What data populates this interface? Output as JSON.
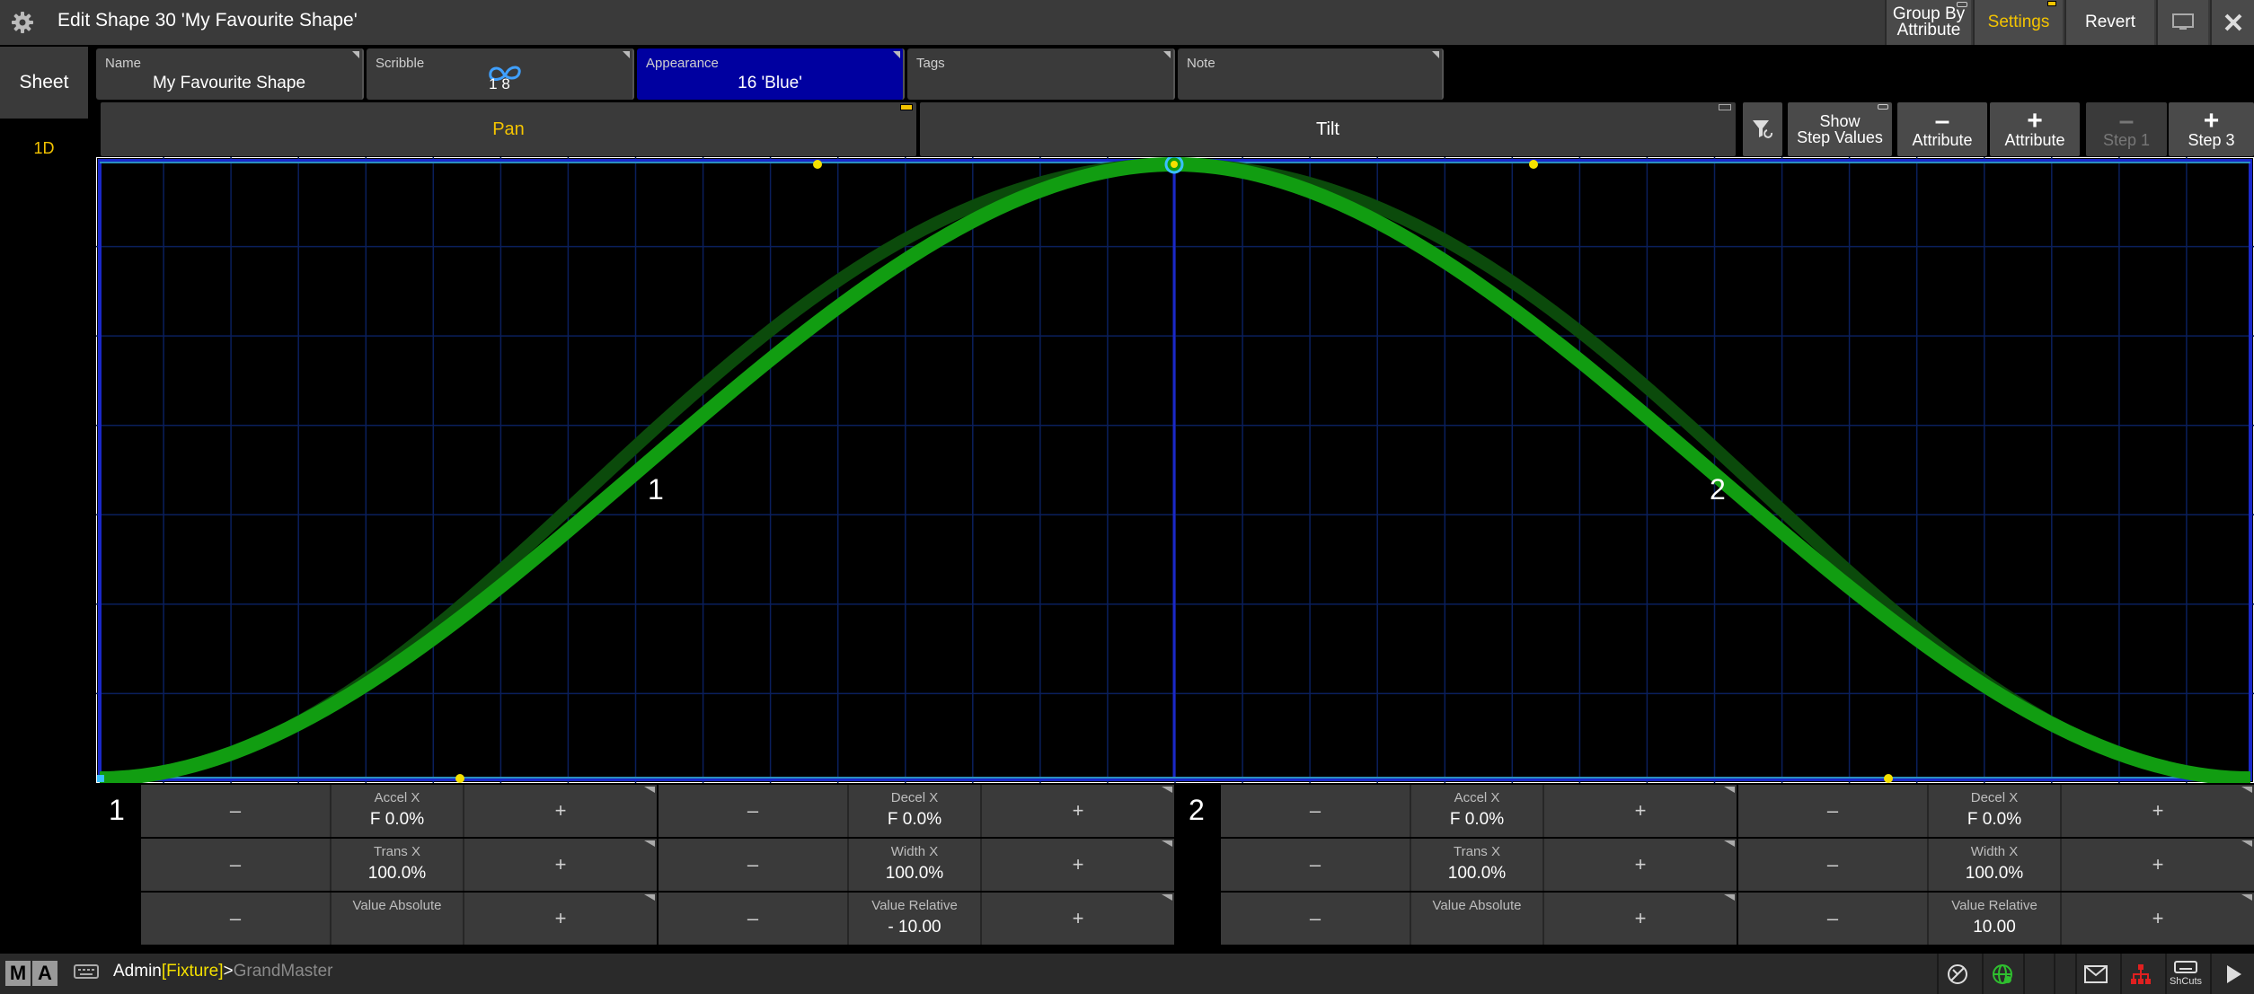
{
  "titlebar": {
    "title": "Edit Shape 30 'My Favourite Shape'",
    "group_by_line1": "Group By",
    "group_by_line2": "Attribute",
    "settings": "Settings",
    "revert": "Revert",
    "accent_color": "#f4c400"
  },
  "sidebar": {
    "sheet": "Sheet",
    "mode": "1D"
  },
  "fields": {
    "name_label": "Name",
    "name_value": "My Favourite Shape",
    "scribble_label": "Scribble",
    "scribble_value": "1 8",
    "appearance_label": "Appearance",
    "appearance_value": "16 'Blue'",
    "appearance_color": "#0000a0",
    "tags_label": "Tags",
    "note_label": "Note"
  },
  "attributes": {
    "pan": "Pan",
    "tilt": "Tilt",
    "show_step_values_line1": "Show",
    "show_step_values_line2": "Step Values",
    "remove_attribute": "Attribute",
    "add_attribute": "Attribute",
    "remove_step": "Step 1",
    "add_step": "Step 3"
  },
  "graph": {
    "step_labels": [
      "1",
      "2"
    ],
    "curve_color": "#119d11",
    "handle_color": "#f4e000",
    "grid_color": "#0a1f5c"
  },
  "steps": [
    {
      "number": "1",
      "accel_label": "Accel X",
      "accel_value": "F  0.0%",
      "decel_label": "Decel X",
      "decel_value": "F  0.0%",
      "trans_label": "Trans X",
      "trans_value": "100.0%",
      "width_label": "Width X",
      "width_value": "100.0%",
      "valabs_label": "Value Absolute",
      "valabs_value": "",
      "valrel_label": "Value Relative",
      "valrel_value": "- 10.00"
    },
    {
      "number": "2",
      "accel_label": "Accel X",
      "accel_value": "F  0.0%",
      "decel_label": "Decel X",
      "decel_value": "F  0.0%",
      "trans_label": "Trans X",
      "trans_value": "100.0%",
      "width_label": "Width X",
      "width_value": "100.0%",
      "valabs_label": "Value Absolute",
      "valabs_value": "",
      "valrel_label": "Value Relative",
      "valrel_value": "10.00"
    }
  ],
  "controls": {
    "minus": "–",
    "plus": "+"
  },
  "statusbar": {
    "ma_m": "M",
    "ma_a": "A",
    "cmd_user": "Admin",
    "cmd_fixture": "[Fixture]",
    "cmd_sep": ">",
    "cmd_target": "GrandMaster",
    "shcuts": "ShCuts"
  }
}
